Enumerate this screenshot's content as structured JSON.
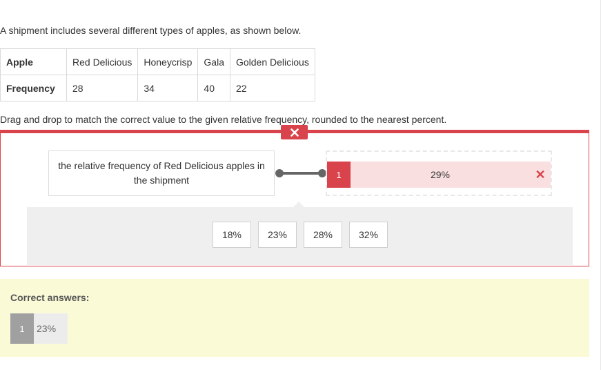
{
  "intro": "A shipment includes several different types of apples, as shown below.",
  "table": {
    "header_label": "Apple",
    "columns": [
      "Red Delicious",
      "Honeycrisp",
      "Gala",
      "Golden Delicious"
    ],
    "row_label": "Frequency",
    "values": [
      "28",
      "34",
      "40",
      "22"
    ]
  },
  "instructions": "Drag and drop to match the correct value to the given relative frequency, rounded to the nearest percent.",
  "question": {
    "prompt": "the relative frequency of Red Delicious apples in the shipment",
    "answer_number": "1",
    "answer_value": "29%",
    "answer_status": "incorrect",
    "status_color": "#d9434b"
  },
  "options": [
    "18%",
    "23%",
    "28%",
    "32%"
  ],
  "feedback": {
    "label": "Correct answers:",
    "number": "1",
    "value": "23%"
  }
}
